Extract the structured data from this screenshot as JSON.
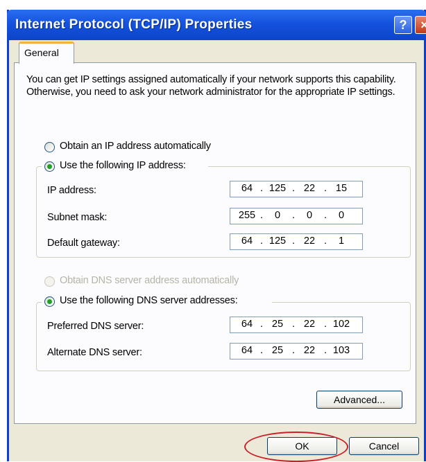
{
  "window": {
    "title": "Internet Protocol (TCP/IP) Properties",
    "help_label": "?",
    "close_label": "×"
  },
  "tabs": [
    {
      "label": "General"
    }
  ],
  "description": "You can get IP settings assigned automatically if your network supports this capability. Otherwise, you need to ask your network administrator for the appropriate IP settings.",
  "ip_section": {
    "auto_label": "Obtain an IP address automatically",
    "manual_label": "Use the following IP address:",
    "selected": "manual",
    "fields": [
      {
        "label": "IP address:",
        "octets": [
          "64",
          "125",
          "22",
          "15"
        ]
      },
      {
        "label": "Subnet mask:",
        "octets": [
          "255",
          "0",
          "0",
          "0"
        ]
      },
      {
        "label": "Default gateway:",
        "octets": [
          "64",
          "125",
          "22",
          "1"
        ]
      }
    ]
  },
  "dns_section": {
    "auto_label": "Obtain DNS server address automatically",
    "manual_label": "Use the following DNS server addresses:",
    "selected": "manual",
    "fields": [
      {
        "label": "Preferred DNS server:",
        "octets": [
          "64",
          "25",
          "22",
          "102"
        ]
      },
      {
        "label": "Alternate DNS server:",
        "octets": [
          "64",
          "25",
          "22",
          "103"
        ]
      }
    ]
  },
  "buttons": {
    "advanced": "Advanced...",
    "ok": "OK",
    "cancel": "Cancel"
  },
  "colors": {
    "titlebar": "#0b45c8",
    "dialog_bg": "#ece9d8",
    "radio_selected": "#21a121",
    "highlight_circle": "#c8202a"
  }
}
